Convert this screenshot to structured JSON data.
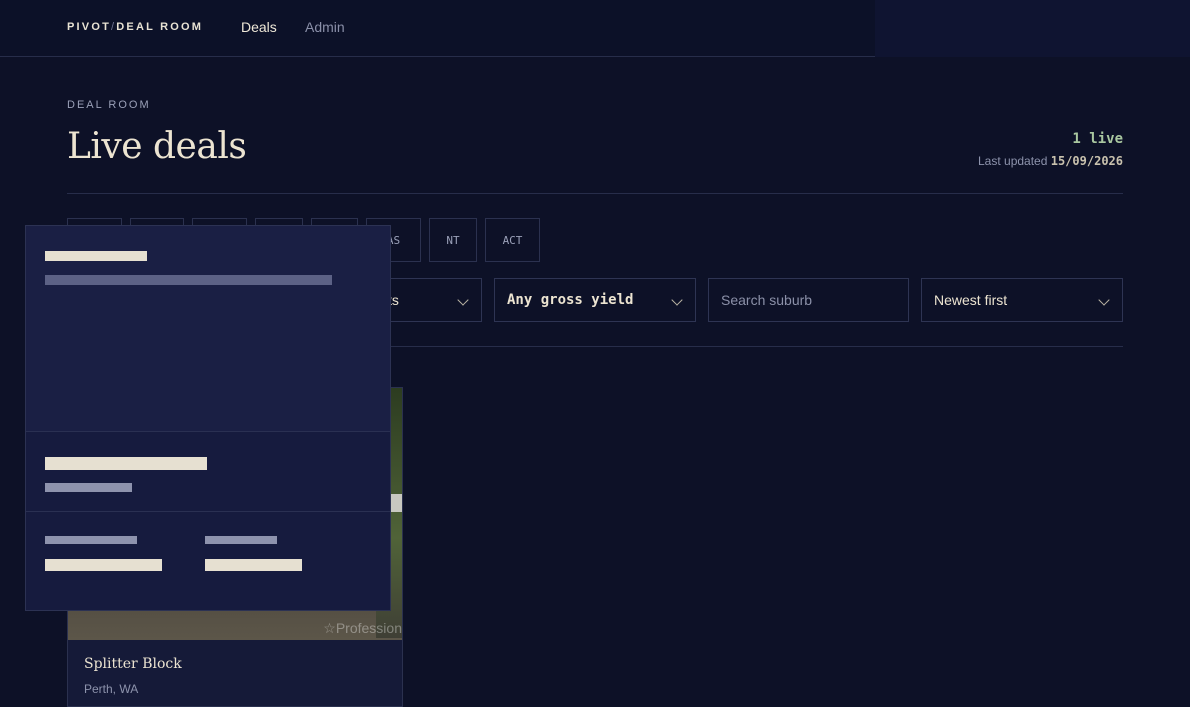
{
  "nav": {
    "brand_left": "PIVOT",
    "brand_sep": "/",
    "brand_right": "DEAL ROOM",
    "links": [
      "Deals",
      "Admin"
    ],
    "active": "Deals"
  },
  "header": {
    "eyebrow": "DEAL ROOM",
    "title": "Live deals",
    "live_count": "1 live",
    "last_updated_label": "Last updated",
    "last_updated_date": "15/09/2026"
  },
  "state_chips": [
    "",
    "",
    "",
    "",
    "",
    "AS",
    "NT",
    "ACT"
  ],
  "filters": {
    "type_select_visible": "ts",
    "yield_select": "Any gross yield",
    "search_placeholder": "Search suburb",
    "sort_select": "Newest first"
  },
  "deal_card": {
    "title": "Splitter Block",
    "location": "Perth, WA",
    "watermark": "Profession"
  },
  "icons": {
    "chevron": "chevron-down-icon",
    "watermark": "star-icon"
  },
  "colors": {
    "background": "#0d1127",
    "text": "#e9e3d4",
    "accent_live": "#a9c7a0",
    "popover": "#161b3e"
  }
}
